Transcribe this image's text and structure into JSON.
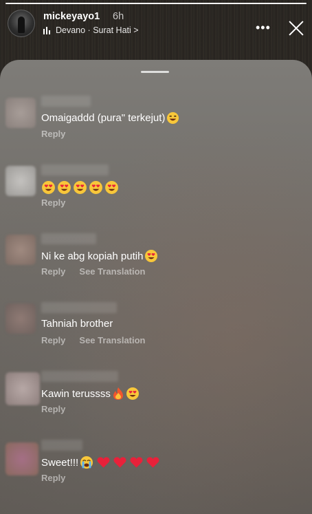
{
  "header": {
    "username": "mickeyayo1",
    "time": "6h",
    "music_text": "Devano · Surat Hati >",
    "progress_fraction": 1.0
  },
  "comments": [
    {
      "text": "Omaigaddd (pura\" terkejut)",
      "emojis": [
        "laughing-face"
      ],
      "reply": "Reply",
      "translate": ""
    },
    {
      "text": "",
      "emojis": [
        "heart-eyes-face",
        "heart-eyes-face",
        "heart-eyes-face",
        "heart-eyes-face",
        "heart-eyes-face"
      ],
      "reply": "Reply",
      "translate": ""
    },
    {
      "text": "Ni ke abg kopiah putih",
      "emojis": [
        "heart-eyes-face"
      ],
      "reply": "Reply",
      "translate": "See Translation"
    },
    {
      "text": "Tahniah brother",
      "emojis": [],
      "reply": "Reply",
      "translate": "See Translation"
    },
    {
      "text": "Kawin terussss",
      "emojis": [
        "fire",
        "heart-eyes-face"
      ],
      "reply": "Reply",
      "translate": ""
    },
    {
      "text": "Sweet!!!",
      "emojis": [
        "crying-face",
        "red-heart",
        "red-heart",
        "red-heart",
        "red-heart"
      ],
      "reply": "Reply",
      "translate": ""
    }
  ],
  "colors": {
    "sheet": "#6f6b66",
    "reply_text": "#ffffff80"
  }
}
